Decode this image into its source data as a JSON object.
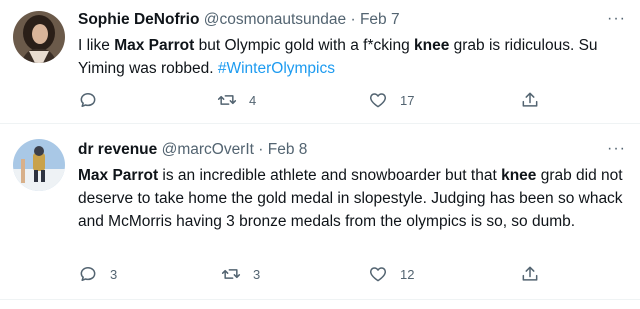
{
  "tweets": [
    {
      "name": "Sophie DeNofrio",
      "handle": "@cosmonautsundae",
      "sep": "·",
      "date": "Feb 7",
      "more": "···",
      "text": [
        {
          "t": "I like "
        },
        {
          "t": "Max Parrot",
          "b": true
        },
        {
          "t": " but Olympic gold with a f*cking "
        },
        {
          "t": "knee",
          "b": true
        },
        {
          "t": " grab is ridiculous. Su Yiming was robbed. "
        },
        {
          "t": "#WinterOlympics",
          "link": true
        }
      ],
      "replies": "",
      "retweets": "4",
      "likes": "17"
    },
    {
      "name": "dr revenue",
      "handle": "@marcOverIt",
      "sep": "·",
      "date": "Feb 8",
      "more": "···",
      "text": [
        {
          "t": "Max Parrot",
          "b": true
        },
        {
          "t": " is an incredible athlete and snowboarder but that "
        },
        {
          "t": "knee",
          "b": true
        },
        {
          "t": " grab did not deserve to take home the gold medal in slopestyle. Judging has been so whack and McMorris having 3 bronze medals from the olympics is so, so dumb."
        }
      ],
      "replies": "3",
      "retweets": "3",
      "likes": "12"
    }
  ],
  "icons": {
    "reply": "reply-icon",
    "retweet": "retweet-icon",
    "like": "heart-icon",
    "share": "share-icon"
  },
  "colors": {
    "text": "#0f1419",
    "secondary": "#536471",
    "link": "#1d9bf0",
    "divider": "#eff3f4"
  }
}
